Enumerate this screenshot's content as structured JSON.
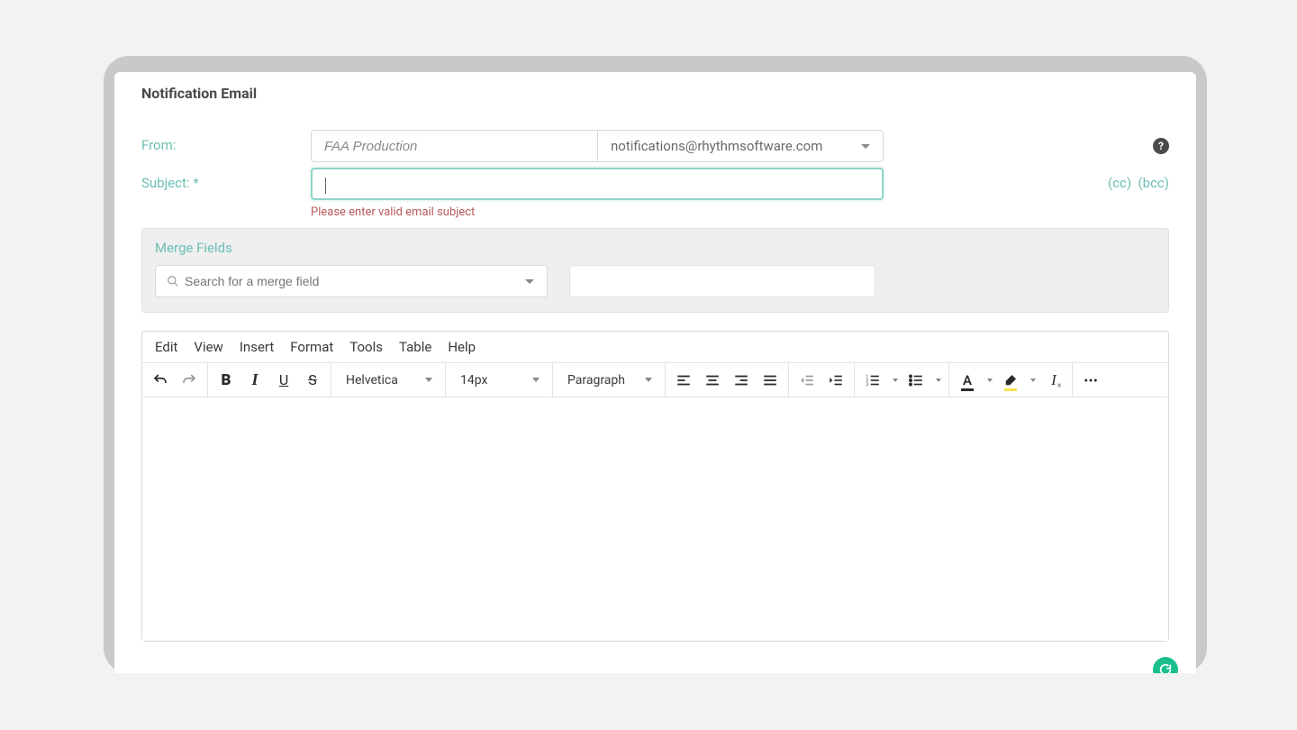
{
  "header": {
    "title": "Notification Email"
  },
  "form": {
    "from_label": "From:",
    "from_name": "FAA Production",
    "from_email": "notifications@rhythmsoftware.com",
    "subject_label": "Subject: *",
    "subject_value": "",
    "subject_error": "Please enter valid email subject",
    "cc_label": "(cc)",
    "bcc_label": "(bcc)"
  },
  "merge": {
    "label": "Merge Fields",
    "search_placeholder": "Search for a merge field"
  },
  "editor": {
    "menu": [
      "Edit",
      "View",
      "Insert",
      "Format",
      "Tools",
      "Table",
      "Help"
    ],
    "font_family": "Helvetica",
    "font_size": "14px",
    "block_format": "Paragraph"
  }
}
